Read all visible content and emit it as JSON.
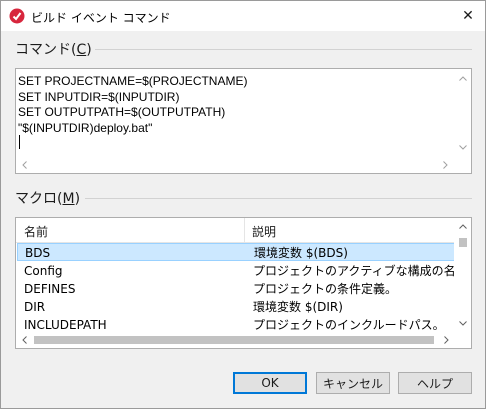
{
  "window": {
    "title": "ビルド イベント コマンド",
    "close_glyph": "✕",
    "app_icon": "embarcadero-icon",
    "accent_color": "#0078d7",
    "icon_color": "#d7263d"
  },
  "command": {
    "label": "コマンド(C)",
    "label_main": "コマンド(",
    "label_key": "C",
    "label_end": ")",
    "text": "SET PROJECTNAME=$(PROJECTNAME)\nSET INPUTDIR=$(INPUTDIR)\nSET OUTPUTPATH=$(OUTPUTPATH)\n\"$(INPUTDIR)deploy.bat\""
  },
  "macros": {
    "label_main": "マクロ(",
    "label_key": "M",
    "label_end": ")",
    "columns": [
      "名前",
      "説明"
    ],
    "rows": [
      {
        "name": "BDS",
        "desc": "環境変数 $(BDS)",
        "selected": true
      },
      {
        "name": "Config",
        "desc": "プロジェクトのアクティブな構成の名前",
        "selected": false
      },
      {
        "name": "DEFINES",
        "desc": "プロジェクトの条件定義。",
        "selected": false
      },
      {
        "name": "DIR",
        "desc": "環境変数 $(DIR)",
        "selected": false
      },
      {
        "name": "INCLUDEPATH",
        "desc": "プロジェクトのインクルードパス。",
        "selected": false
      }
    ],
    "selection_color": "#cce8ff"
  },
  "buttons": {
    "ok": "OK",
    "cancel": "キャンセル",
    "help": "ヘルプ"
  }
}
